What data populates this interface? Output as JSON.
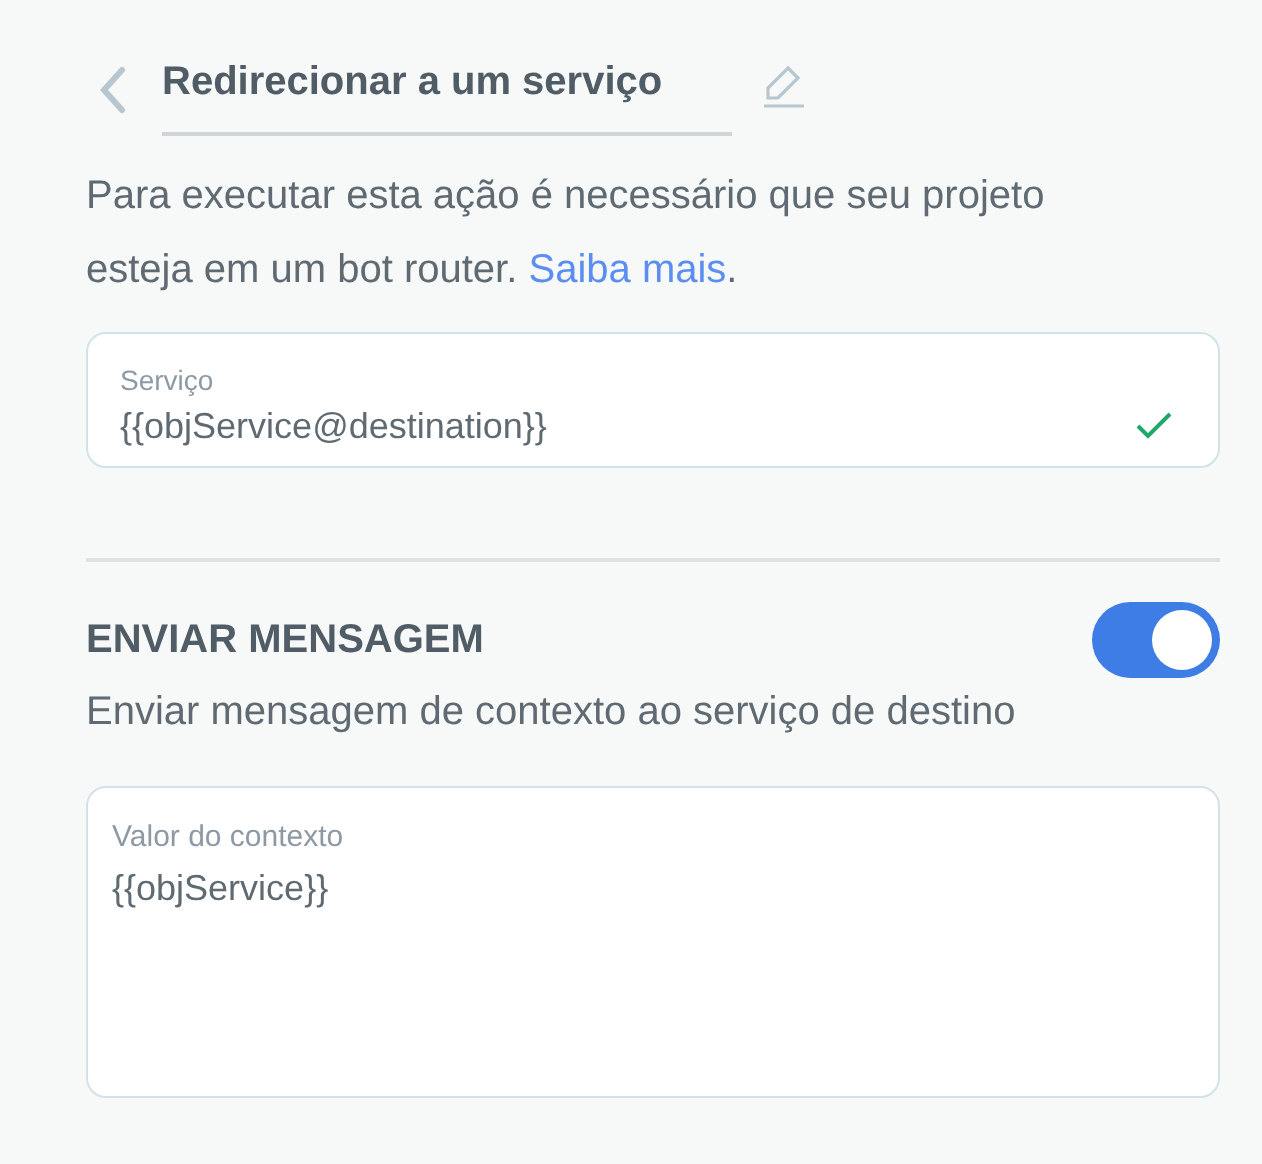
{
  "header": {
    "title": "Redirecionar a um serviço"
  },
  "description": {
    "text": "Para executar esta ação é necessário que seu projeto esteja em um bot router.",
    "link": "Saiba mais",
    "after": "."
  },
  "service_field": {
    "label": "Serviço",
    "value": "{{objService@destination}}",
    "valid": true
  },
  "send_message": {
    "title": "ENVIAR MENSAGEM",
    "on": true,
    "subtitle": "Enviar mensagem de contexto ao serviço de destino"
  },
  "context_field": {
    "label": "Valor do contexto",
    "value": "{{objService}}"
  }
}
